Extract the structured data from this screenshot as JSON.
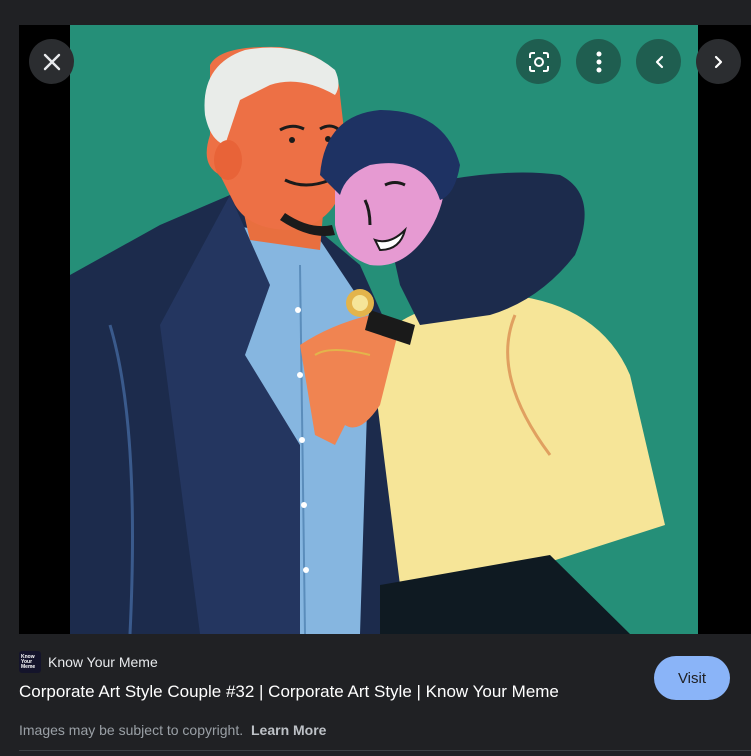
{
  "viewer": {
    "close_icon": "close-icon",
    "lens_icon": "google-lens-icon",
    "more_icon": "more-vert-icon",
    "prev_icon": "chevron-left-icon",
    "next_icon": "chevron-right-icon",
    "image_background": "#258f78"
  },
  "source": {
    "favicon_text": [
      "Know",
      "Your",
      "Meme"
    ],
    "name": "Know Your Meme"
  },
  "title": "Corporate Art Style Couple #32 | Corporate Art Style | Know Your Meme",
  "copyright": {
    "text": "Images may be subject to copyright.",
    "link": "Learn More"
  },
  "visit_label": "Visit",
  "colors": {
    "accent": "#8ab4f8",
    "background": "#202124"
  }
}
